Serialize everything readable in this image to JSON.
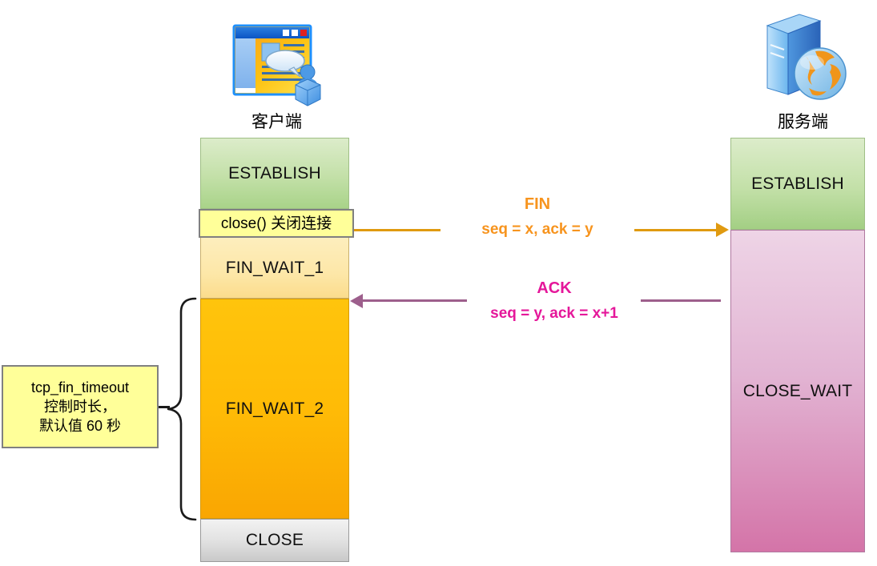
{
  "diagram": {
    "title": "TCP four-way handshake close (FIN_WAIT_2 / tcp_fin_timeout)",
    "client": {
      "label": "客户端",
      "icon": "client-browser-user-icon",
      "states": [
        {
          "name": "ESTABLISH",
          "label": "ESTABLISH"
        },
        {
          "name": "FIN_WAIT_1",
          "label": "FIN_WAIT_1"
        },
        {
          "name": "FIN_WAIT_2",
          "label": "FIN_WAIT_2"
        },
        {
          "name": "CLOSE",
          "label": "CLOSE"
        }
      ]
    },
    "server": {
      "label": "服务端",
      "icon": "server-globe-icon",
      "states": [
        {
          "name": "ESTABLISH",
          "label": "ESTABLISH"
        },
        {
          "name": "CLOSE_WAIT",
          "label": "CLOSE_WAIT"
        }
      ]
    },
    "callouts": [
      {
        "id": "close-call",
        "text": "close() 关闭连接"
      },
      {
        "id": "fin-timeout",
        "line1": "tcp_fin_timeout",
        "line2": "控制时长，",
        "line3": "默认值 60 秒"
      }
    ],
    "messages": [
      {
        "id": "fin",
        "title": "FIN",
        "detail": "seq = x,  ack = y",
        "direction": "client-to-server",
        "color": "#f7941e",
        "line_color": "#e09a10"
      },
      {
        "id": "ack",
        "title": "ACK",
        "detail": "seq = y,  ack = x+1",
        "direction": "server-to-client",
        "color": "#e5179a",
        "line_color": "#9d5f8c"
      }
    ],
    "colors": {
      "establish": "#c3e0a8",
      "fin_wait_1": "#fde7a8",
      "fin_wait_2": "#ffbb06",
      "close": "#e2e2e2",
      "close_wait": "#e2b4d3",
      "callout": "#ffff99",
      "fin_accent": "#f7941e",
      "ack_accent": "#e5179a"
    }
  }
}
